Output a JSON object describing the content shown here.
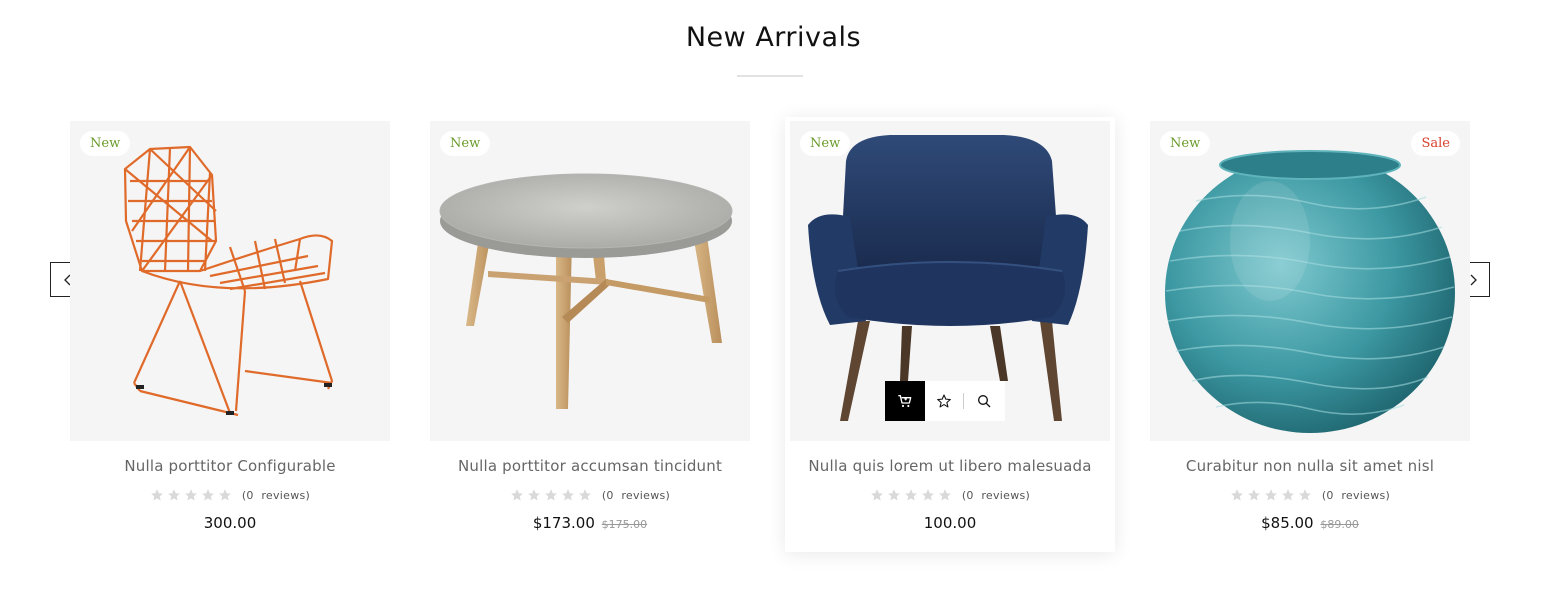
{
  "section": {
    "title": "New Arrivals"
  },
  "carousel": {
    "prev_icon": "chevron-left-icon",
    "next_icon": "chevron-right-icon"
  },
  "colors": {
    "badge_new": "#6a9a2b",
    "badge_sale": "#d9412d",
    "cart_button_bg": "#000000",
    "card_bg": "#f5f5f5"
  },
  "products": [
    {
      "name": "Nulla porttitor Configurable",
      "badges": [
        "New"
      ],
      "rating": 0,
      "reviews_open": "(0",
      "reviews_word": "reviews)",
      "price": "300.00",
      "old_price": ""
    },
    {
      "name": "Nulla porttitor accumsan tincidunt",
      "badges": [
        "New"
      ],
      "rating": 0,
      "reviews_open": "(0",
      "reviews_word": "reviews)",
      "price": "$173.00",
      "old_price": "$175.00"
    },
    {
      "name": "Nulla quis lorem ut libero malesuada",
      "badges": [
        "New"
      ],
      "rating": 0,
      "reviews_open": "(0",
      "reviews_word": "reviews)",
      "price": "100.00",
      "old_price": "",
      "hover_actions": [
        "cart-icon",
        "star-outline-icon",
        "search-icon"
      ]
    },
    {
      "name": "Curabitur non nulla sit amet nisl",
      "badges": [
        "New",
        "Sale"
      ],
      "rating": 0,
      "reviews_open": "(0",
      "reviews_word": "reviews)",
      "price": "$85.00",
      "old_price": "$89.00"
    }
  ]
}
